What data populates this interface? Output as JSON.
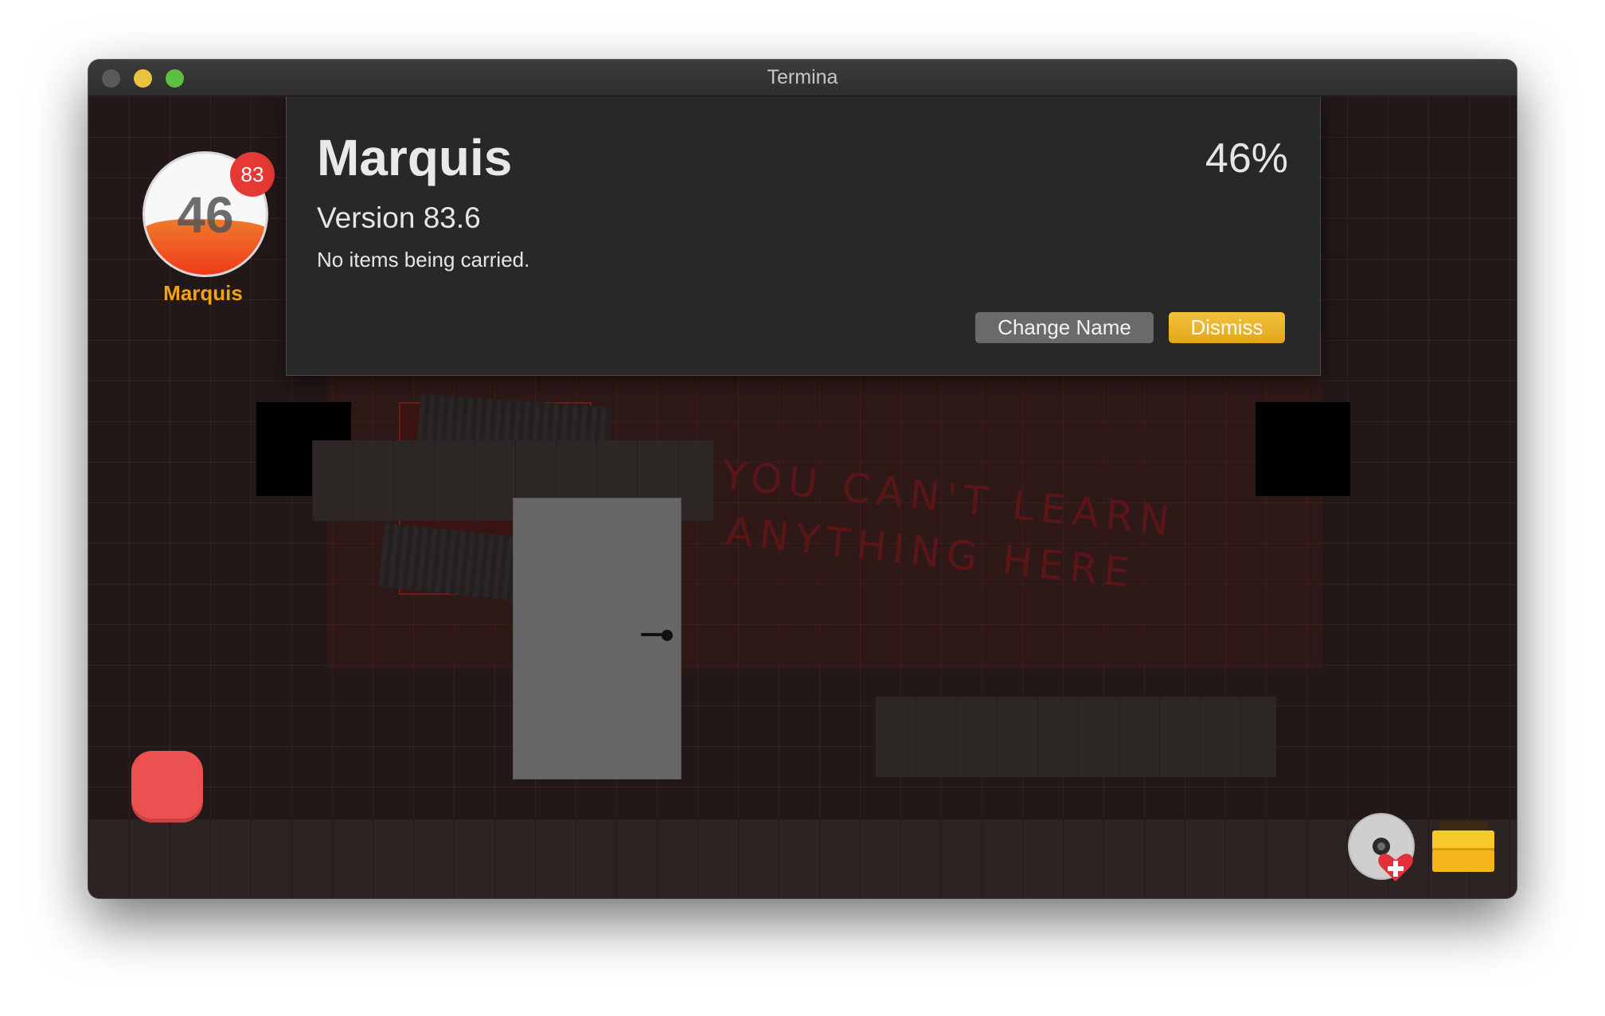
{
  "window": {
    "title": "Termina"
  },
  "player": {
    "name": "Marquis",
    "level": "46",
    "badge": "83",
    "fill_percent": 46
  },
  "dialog": {
    "title": "Marquis",
    "version": "Version 83.6",
    "items_text": "No items being carried.",
    "percent": "46%",
    "change_name_label": "Change Name",
    "dismiss_label": "Dismiss"
  },
  "scene": {
    "wall_text_line1": "YOU CAN'T LEARN",
    "wall_text_line2": "ANYTHING HERE"
  },
  "icons": {
    "stop_button": "red-square-button",
    "disc": "disc-heart-icon",
    "box": "toolbox-icon"
  },
  "colors": {
    "accent": "#f2a30f",
    "badge": "#e53935",
    "dismiss": "#e9b22a",
    "stop_button": "#ec5151"
  }
}
